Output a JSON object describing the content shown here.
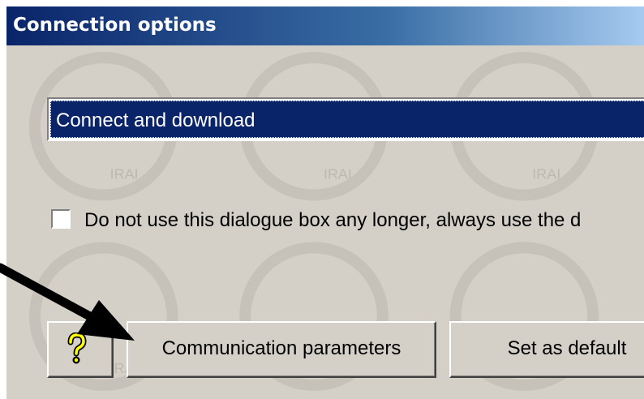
{
  "window": {
    "title": "Connection options"
  },
  "combo": {
    "selected": "Connect and download"
  },
  "option": {
    "label": "Do not use this dialogue box any longer, always use the d",
    "checked": false
  },
  "buttons": {
    "help_icon": "question-mark-icon",
    "communication": "Communication parameters",
    "set_default": "Set as default"
  },
  "watermark": {
    "text": "IRAI"
  },
  "colors": {
    "title_start": "#0a246a",
    "selection": "#0a246a",
    "dialog": "#d4d0c8",
    "help_yellow": "#ffff00"
  }
}
